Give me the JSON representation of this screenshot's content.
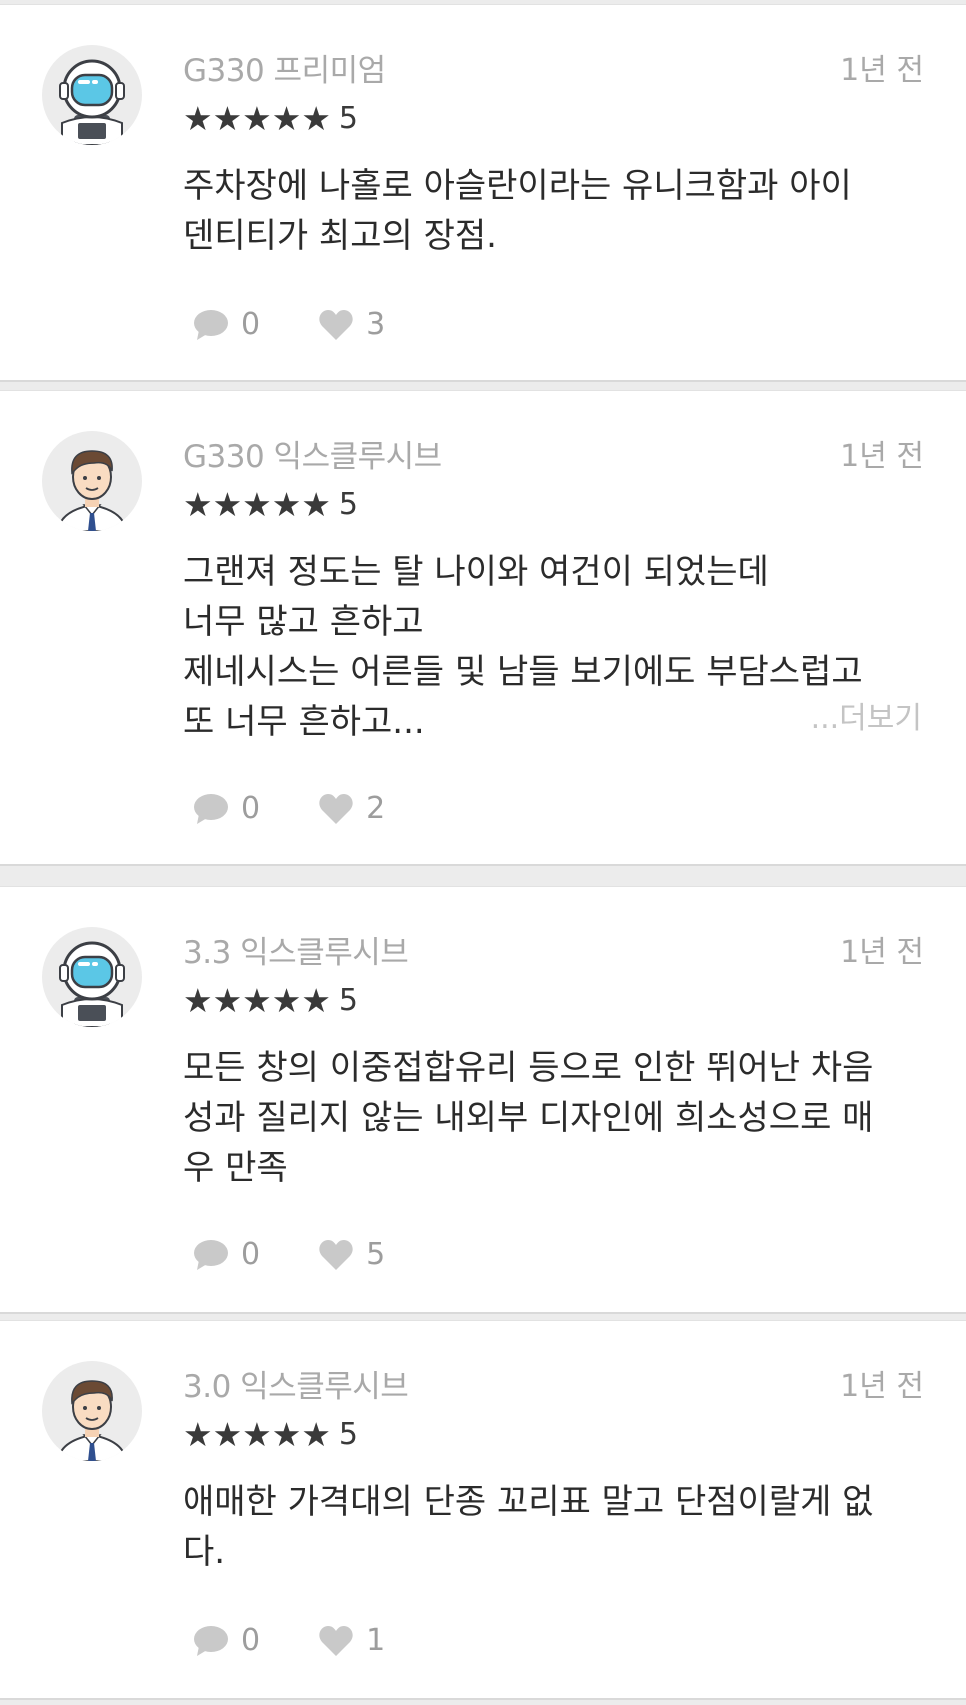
{
  "reviews": [
    {
      "trim": "G330 프리미엄",
      "time": "1년 전",
      "stars": "★★★★★",
      "score": "5",
      "body": "주차장에 나홀로 아슬란이라는 유니크함과 아이\n덴티티가 최고의 장점.",
      "comments": "0",
      "likes": "3",
      "avatar": "astronaut"
    },
    {
      "trim": "G330 익스클루시브",
      "time": "1년 전",
      "stars": "★★★★★",
      "score": "5",
      "body": "그랜져 정도는 탈 나이와 여건이 되었는데\n너무 많고 흔하고\n제네시스는 어른들 및 남들 보기에도 부담스럽고\n또 너무 흔하고...",
      "more": "...더보기",
      "comments": "0",
      "likes": "2",
      "avatar": "businessman"
    },
    {
      "trim": "3.3 익스클루시브",
      "time": "1년 전",
      "stars": "★★★★★",
      "score": "5",
      "body": "모든 창의 이중접합유리 등으로 인한 뛰어난 차음\n성과 질리지 않는 내외부 디자인에 희소성으로 매\n우 만족",
      "comments": "0",
      "likes": "5",
      "avatar": "astronaut"
    },
    {
      "trim": "3.0 익스클루시브",
      "time": "1년 전",
      "stars": "★★★★★",
      "score": "5",
      "body": "애매한 가격대의 단종 꼬리표 말고 단점이랄게 없\n다.",
      "comments": "0",
      "likes": "1",
      "avatar": "businessman"
    }
  ]
}
